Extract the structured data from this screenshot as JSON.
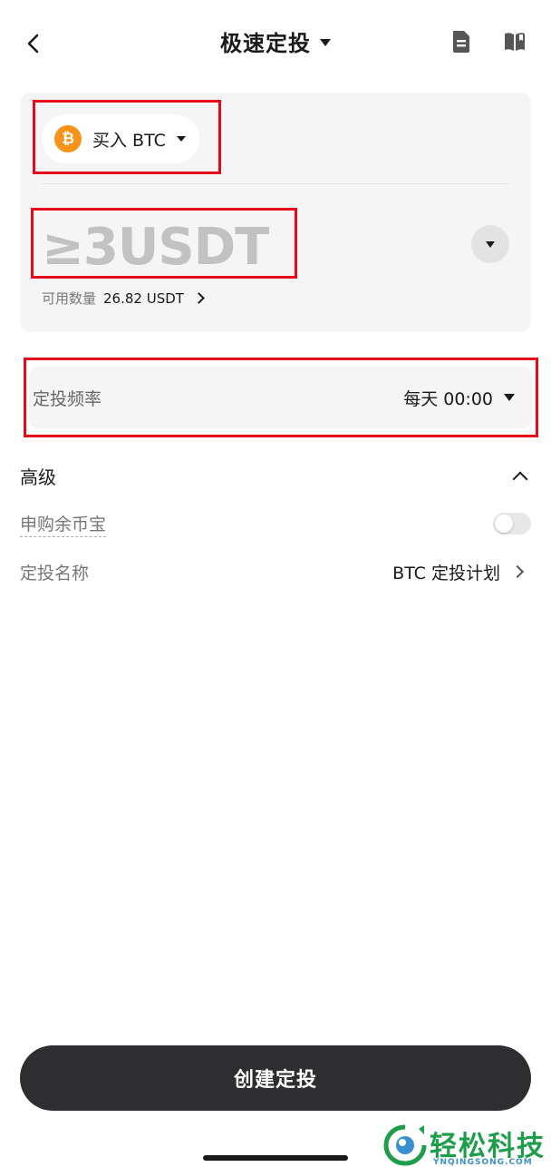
{
  "header": {
    "title": "极速定投"
  },
  "amount_card": {
    "buy_label": "买入 BTC",
    "coin_glyph": "₿",
    "coin_color": "#f7931a",
    "amount_placeholder": "≥3USDT",
    "available_label": "可用数量",
    "available_value": "26.82 USDT"
  },
  "frequency": {
    "label": "定投频率",
    "value": "每天 00:00"
  },
  "advanced": {
    "title": "高级",
    "subscribe_label": "申购余币宝",
    "subscribe_enabled": false,
    "plan_name_label": "定投名称",
    "plan_name_value": "BTC 定投计划"
  },
  "footer": {
    "create_label": "创建定投"
  },
  "watermark": {
    "text": "轻松科技",
    "sub": "YNQINGSONG.COM"
  },
  "colors": {
    "highlight": "#e6081b",
    "button_bg": "#2e2e30",
    "card_bg": "#f5f5f5"
  }
}
